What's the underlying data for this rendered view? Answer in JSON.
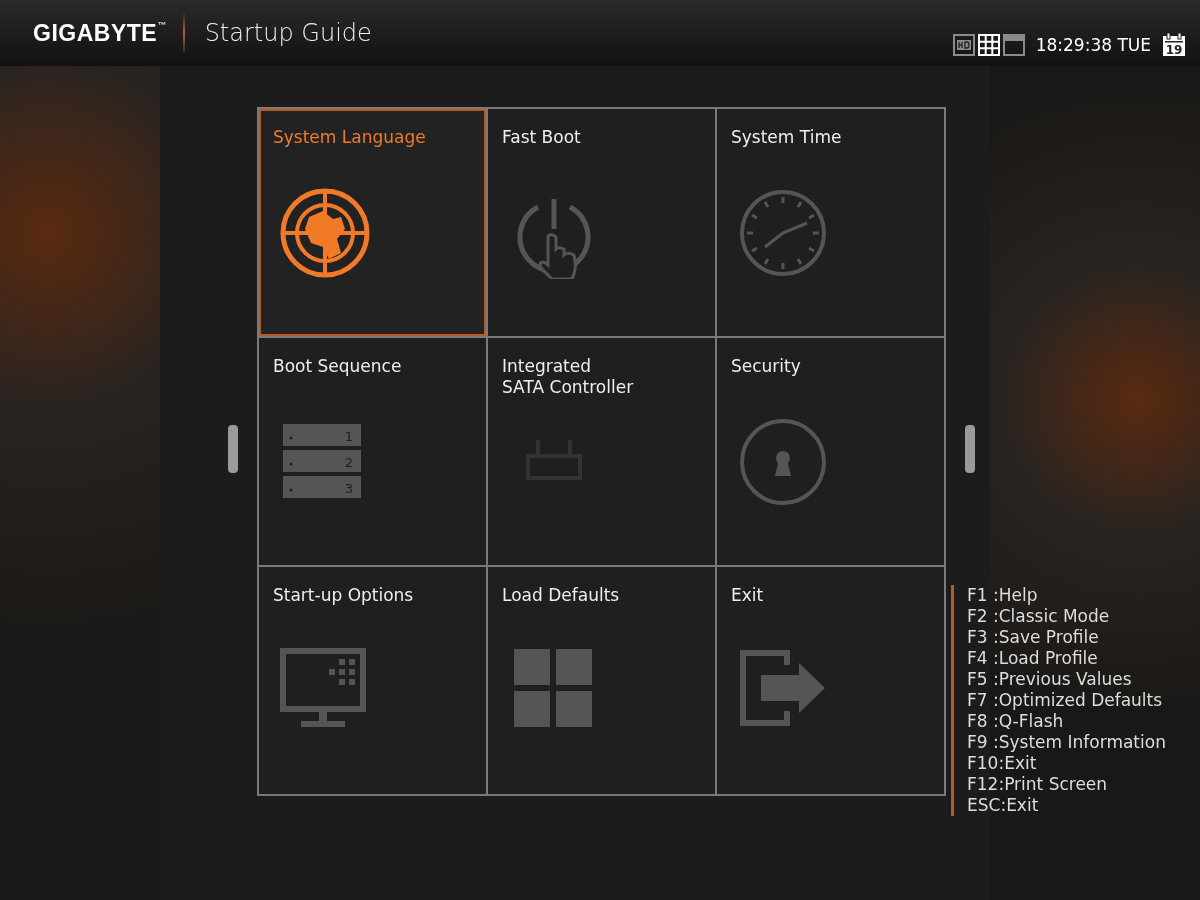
{
  "header": {
    "brand": "GIGABYTE",
    "brand_mark": "™",
    "title": "Startup Guide",
    "view_modes": [
      {
        "kind": "hd",
        "selected": false
      },
      {
        "kind": "grid",
        "selected": true
      },
      {
        "kind": "single",
        "selected": false
      }
    ],
    "time": "18:29:38 TUE",
    "date_day": "19"
  },
  "tiles": [
    {
      "label": "System Language",
      "kind": "globe",
      "selected": true
    },
    {
      "label": "Fast Boot",
      "kind": "power",
      "selected": false
    },
    {
      "label": "System Time",
      "kind": "clock",
      "selected": false
    },
    {
      "label": "Boot Sequence",
      "kind": "list",
      "selected": false,
      "icon_labels": [
        "1",
        "2",
        "3"
      ]
    },
    {
      "label": "Integrated\nSATA Controller",
      "kind": "sata",
      "selected": false
    },
    {
      "label": "Security",
      "kind": "lock",
      "selected": false
    },
    {
      "label": "Start-up Options",
      "kind": "monitor",
      "selected": false
    },
    {
      "label": "Load Defaults",
      "kind": "windows",
      "selected": false
    },
    {
      "label": "Exit",
      "kind": "exit",
      "selected": false
    }
  ],
  "help_keys": [
    "F1 :Help",
    "F2 :Classic Mode",
    "F3 :Save Profile",
    "F4 :Load Profile",
    "F5 :Previous Values",
    "F7 :Optimized Defaults",
    "F8 :Q-Flash",
    "F9 :System Information",
    "F10:Exit",
    "F12:Print Screen",
    "ESC:Exit"
  ]
}
